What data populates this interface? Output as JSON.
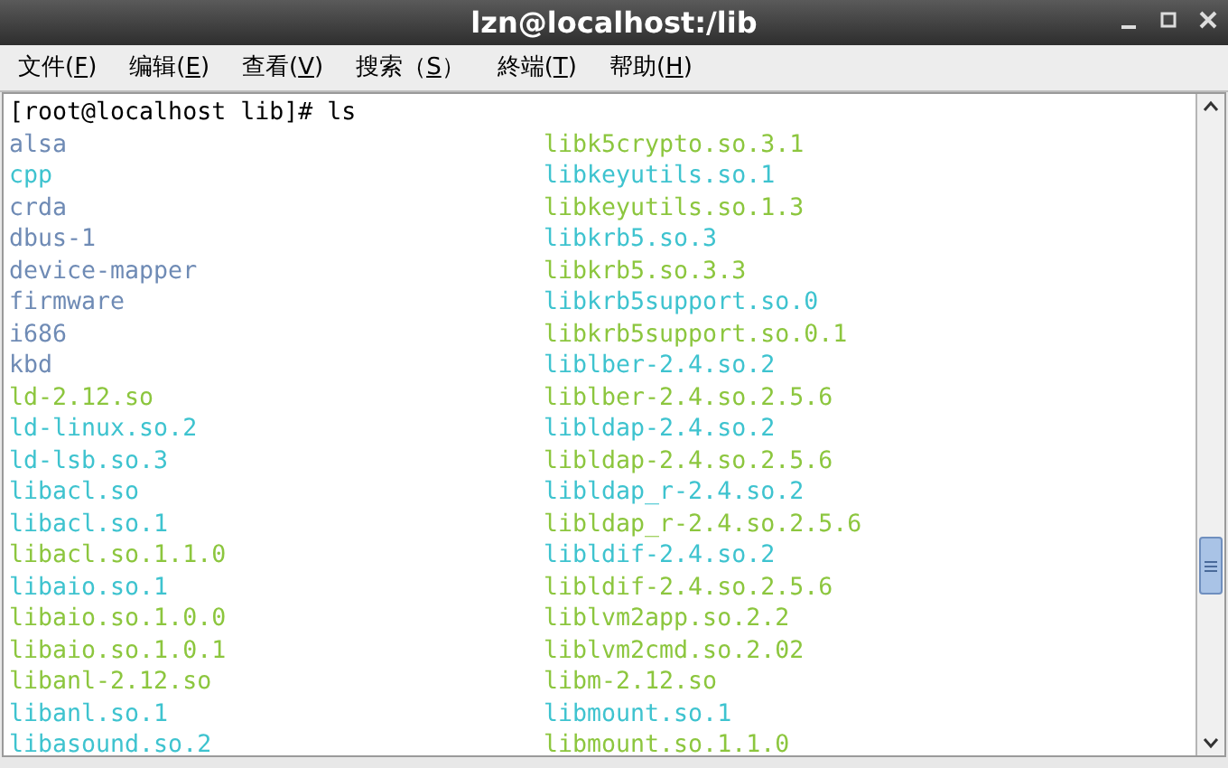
{
  "window": {
    "title": "lzn@localhost:/lib"
  },
  "menu": [
    {
      "before": "文件(",
      "key": "F",
      "after": ")"
    },
    {
      "before": "编辑(",
      "key": "E",
      "after": ")"
    },
    {
      "before": "查看(",
      "key": "V",
      "after": ")"
    },
    {
      "before": "搜索（",
      "key": "S",
      "after": "）"
    },
    {
      "before": "終端(",
      "key": "T",
      "after": ")"
    },
    {
      "before": "帮助(",
      "key": "H",
      "after": ")"
    }
  ],
  "terminal": {
    "prompt": "[root@localhost lib]# ls",
    "columns": [
      [
        {
          "name": "alsa",
          "kind": "dir"
        },
        {
          "name": "cpp",
          "kind": "link"
        },
        {
          "name": "crda",
          "kind": "dir"
        },
        {
          "name": "dbus-1",
          "kind": "dir"
        },
        {
          "name": "device-mapper",
          "kind": "dir"
        },
        {
          "name": "firmware",
          "kind": "dir"
        },
        {
          "name": "i686",
          "kind": "dir"
        },
        {
          "name": "kbd",
          "kind": "dir"
        },
        {
          "name": "ld-2.12.so",
          "kind": "file"
        },
        {
          "name": "ld-linux.so.2",
          "kind": "link"
        },
        {
          "name": "ld-lsb.so.3",
          "kind": "link"
        },
        {
          "name": "libacl.so",
          "kind": "link"
        },
        {
          "name": "libacl.so.1",
          "kind": "link"
        },
        {
          "name": "libacl.so.1.1.0",
          "kind": "file"
        },
        {
          "name": "libaio.so.1",
          "kind": "link"
        },
        {
          "name": "libaio.so.1.0.0",
          "kind": "file"
        },
        {
          "name": "libaio.so.1.0.1",
          "kind": "file"
        },
        {
          "name": "libanl-2.12.so",
          "kind": "file"
        },
        {
          "name": "libanl.so.1",
          "kind": "link"
        },
        {
          "name": "libasound.so.2",
          "kind": "link"
        }
      ],
      [
        {
          "name": "libk5crypto.so.3.1",
          "kind": "file"
        },
        {
          "name": "libkeyutils.so.1",
          "kind": "link"
        },
        {
          "name": "libkeyutils.so.1.3",
          "kind": "file"
        },
        {
          "name": "libkrb5.so.3",
          "kind": "link"
        },
        {
          "name": "libkrb5.so.3.3",
          "kind": "file"
        },
        {
          "name": "libkrb5support.so.0",
          "kind": "link"
        },
        {
          "name": "libkrb5support.so.0.1",
          "kind": "file"
        },
        {
          "name": "liblber-2.4.so.2",
          "kind": "link"
        },
        {
          "name": "liblber-2.4.so.2.5.6",
          "kind": "file"
        },
        {
          "name": "libldap-2.4.so.2",
          "kind": "link"
        },
        {
          "name": "libldap-2.4.so.2.5.6",
          "kind": "file"
        },
        {
          "name": "libldap_r-2.4.so.2",
          "kind": "link"
        },
        {
          "name": "libldap_r-2.4.so.2.5.6",
          "kind": "file"
        },
        {
          "name": "libldif-2.4.so.2",
          "kind": "link"
        },
        {
          "name": "libldif-2.4.so.2.5.6",
          "kind": "file"
        },
        {
          "name": "liblvm2app.so.2.2",
          "kind": "file"
        },
        {
          "name": "liblvm2cmd.so.2.02",
          "kind": "file"
        },
        {
          "name": "libm-2.12.so",
          "kind": "file"
        },
        {
          "name": "libmount.so.1",
          "kind": "link"
        },
        {
          "name": "libmount.so.1.1.0",
          "kind": "file"
        }
      ]
    ]
  }
}
